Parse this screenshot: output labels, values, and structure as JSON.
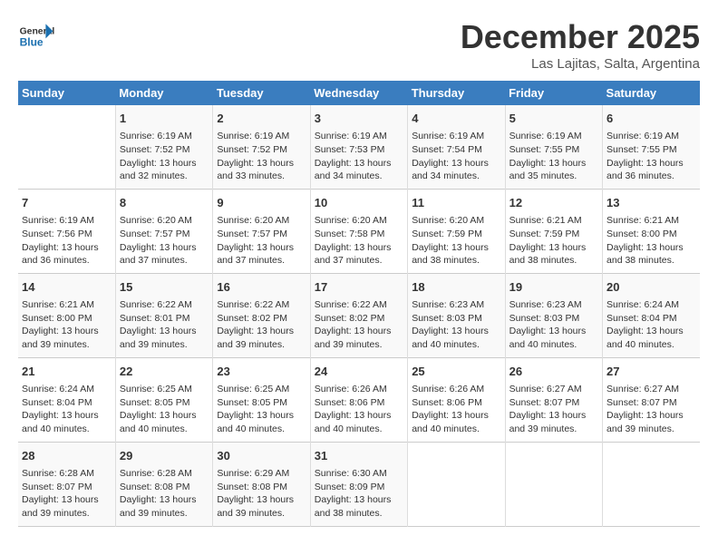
{
  "header": {
    "logo_general": "General",
    "logo_blue": "Blue",
    "month_title": "December 2025",
    "location": "Las Lajitas, Salta, Argentina"
  },
  "weekdays": [
    "Sunday",
    "Monday",
    "Tuesday",
    "Wednesday",
    "Thursday",
    "Friday",
    "Saturday"
  ],
  "weeks": [
    [
      {
        "num": "",
        "info": ""
      },
      {
        "num": "1",
        "info": "Sunrise: 6:19 AM\nSunset: 7:52 PM\nDaylight: 13 hours\nand 32 minutes."
      },
      {
        "num": "2",
        "info": "Sunrise: 6:19 AM\nSunset: 7:52 PM\nDaylight: 13 hours\nand 33 minutes."
      },
      {
        "num": "3",
        "info": "Sunrise: 6:19 AM\nSunset: 7:53 PM\nDaylight: 13 hours\nand 34 minutes."
      },
      {
        "num": "4",
        "info": "Sunrise: 6:19 AM\nSunset: 7:54 PM\nDaylight: 13 hours\nand 34 minutes."
      },
      {
        "num": "5",
        "info": "Sunrise: 6:19 AM\nSunset: 7:55 PM\nDaylight: 13 hours\nand 35 minutes."
      },
      {
        "num": "6",
        "info": "Sunrise: 6:19 AM\nSunset: 7:55 PM\nDaylight: 13 hours\nand 36 minutes."
      }
    ],
    [
      {
        "num": "7",
        "info": "Sunrise: 6:19 AM\nSunset: 7:56 PM\nDaylight: 13 hours\nand 36 minutes."
      },
      {
        "num": "8",
        "info": "Sunrise: 6:20 AM\nSunset: 7:57 PM\nDaylight: 13 hours\nand 37 minutes."
      },
      {
        "num": "9",
        "info": "Sunrise: 6:20 AM\nSunset: 7:57 PM\nDaylight: 13 hours\nand 37 minutes."
      },
      {
        "num": "10",
        "info": "Sunrise: 6:20 AM\nSunset: 7:58 PM\nDaylight: 13 hours\nand 37 minutes."
      },
      {
        "num": "11",
        "info": "Sunrise: 6:20 AM\nSunset: 7:59 PM\nDaylight: 13 hours\nand 38 minutes."
      },
      {
        "num": "12",
        "info": "Sunrise: 6:21 AM\nSunset: 7:59 PM\nDaylight: 13 hours\nand 38 minutes."
      },
      {
        "num": "13",
        "info": "Sunrise: 6:21 AM\nSunset: 8:00 PM\nDaylight: 13 hours\nand 38 minutes."
      }
    ],
    [
      {
        "num": "14",
        "info": "Sunrise: 6:21 AM\nSunset: 8:00 PM\nDaylight: 13 hours\nand 39 minutes."
      },
      {
        "num": "15",
        "info": "Sunrise: 6:22 AM\nSunset: 8:01 PM\nDaylight: 13 hours\nand 39 minutes."
      },
      {
        "num": "16",
        "info": "Sunrise: 6:22 AM\nSunset: 8:02 PM\nDaylight: 13 hours\nand 39 minutes."
      },
      {
        "num": "17",
        "info": "Sunrise: 6:22 AM\nSunset: 8:02 PM\nDaylight: 13 hours\nand 39 minutes."
      },
      {
        "num": "18",
        "info": "Sunrise: 6:23 AM\nSunset: 8:03 PM\nDaylight: 13 hours\nand 40 minutes."
      },
      {
        "num": "19",
        "info": "Sunrise: 6:23 AM\nSunset: 8:03 PM\nDaylight: 13 hours\nand 40 minutes."
      },
      {
        "num": "20",
        "info": "Sunrise: 6:24 AM\nSunset: 8:04 PM\nDaylight: 13 hours\nand 40 minutes."
      }
    ],
    [
      {
        "num": "21",
        "info": "Sunrise: 6:24 AM\nSunset: 8:04 PM\nDaylight: 13 hours\nand 40 minutes."
      },
      {
        "num": "22",
        "info": "Sunrise: 6:25 AM\nSunset: 8:05 PM\nDaylight: 13 hours\nand 40 minutes."
      },
      {
        "num": "23",
        "info": "Sunrise: 6:25 AM\nSunset: 8:05 PM\nDaylight: 13 hours\nand 40 minutes."
      },
      {
        "num": "24",
        "info": "Sunrise: 6:26 AM\nSunset: 8:06 PM\nDaylight: 13 hours\nand 40 minutes."
      },
      {
        "num": "25",
        "info": "Sunrise: 6:26 AM\nSunset: 8:06 PM\nDaylight: 13 hours\nand 40 minutes."
      },
      {
        "num": "26",
        "info": "Sunrise: 6:27 AM\nSunset: 8:07 PM\nDaylight: 13 hours\nand 39 minutes."
      },
      {
        "num": "27",
        "info": "Sunrise: 6:27 AM\nSunset: 8:07 PM\nDaylight: 13 hours\nand 39 minutes."
      }
    ],
    [
      {
        "num": "28",
        "info": "Sunrise: 6:28 AM\nSunset: 8:07 PM\nDaylight: 13 hours\nand 39 minutes."
      },
      {
        "num": "29",
        "info": "Sunrise: 6:28 AM\nSunset: 8:08 PM\nDaylight: 13 hours\nand 39 minutes."
      },
      {
        "num": "30",
        "info": "Sunrise: 6:29 AM\nSunset: 8:08 PM\nDaylight: 13 hours\nand 39 minutes."
      },
      {
        "num": "31",
        "info": "Sunrise: 6:30 AM\nSunset: 8:09 PM\nDaylight: 13 hours\nand 38 minutes."
      },
      {
        "num": "",
        "info": ""
      },
      {
        "num": "",
        "info": ""
      },
      {
        "num": "",
        "info": ""
      }
    ]
  ]
}
